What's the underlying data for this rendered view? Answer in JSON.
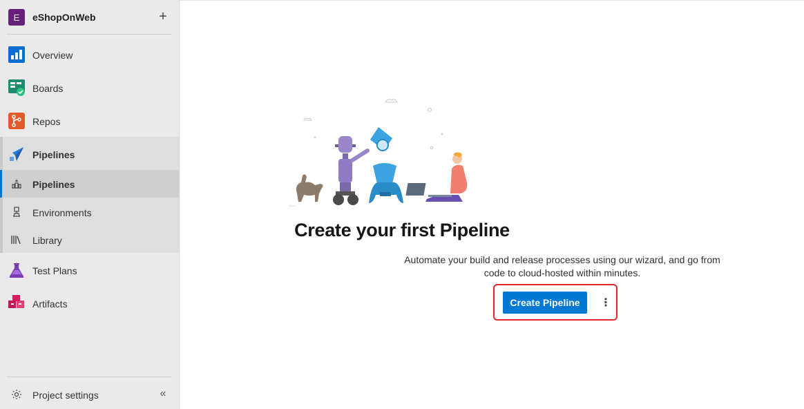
{
  "project": {
    "avatar_letter": "E",
    "name": "eShopOnWeb",
    "add_icon": "plus-icon"
  },
  "nav": {
    "items": [
      {
        "label": "Overview",
        "icon": "overview-icon"
      },
      {
        "label": "Boards",
        "icon": "boards-icon"
      },
      {
        "label": "Repos",
        "icon": "repos-icon"
      },
      {
        "label": "Pipelines",
        "icon": "pipelines-icon"
      },
      {
        "label": "Test Plans",
        "icon": "test-plans-icon"
      },
      {
        "label": "Artifacts",
        "icon": "artifacts-icon"
      }
    ],
    "pipelines_sub": [
      {
        "label": "Pipelines",
        "icon": "pipelines-list-icon",
        "active": true
      },
      {
        "label": "Environments",
        "icon": "environments-icon"
      },
      {
        "label": "Library",
        "icon": "library-icon"
      }
    ]
  },
  "footer": {
    "settings_label": "Project settings",
    "settings_icon": "gear-icon",
    "collapse_icon": "double-chevron-left-icon"
  },
  "main": {
    "title": "Create your first Pipeline",
    "description": "Automate your build and release processes using our wizard, and go from code to cloud-hosted within minutes.",
    "create_button": "Create Pipeline",
    "more_icon": "more-vertical-icon"
  },
  "colors": {
    "accent": "#0078d4",
    "highlight": "#e3262b",
    "sidebar_bg": "#eaeaea",
    "avatar_bg": "#68217a"
  }
}
